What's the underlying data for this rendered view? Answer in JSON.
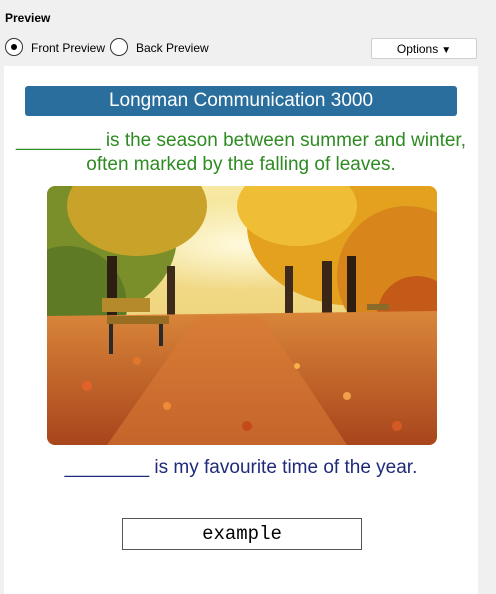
{
  "header": {
    "title": "Preview"
  },
  "preview_mode": {
    "front_label": "Front Preview",
    "back_label": "Back Preview",
    "selected": "front"
  },
  "options": {
    "label": "Options",
    "caret": "▼"
  },
  "card": {
    "deck_name": "Longman Communication 3000",
    "sentence_1": "________ is the season between summer and winter, often marked by the falling of leaves.",
    "image_description_icon": "autumn-park-photo",
    "sentence_2": "________ is my favourite time of the year.",
    "answer_value": "example"
  },
  "colors": {
    "banner": "#2a6e9e",
    "sentence_1": "#2e8b22",
    "sentence_2": "#1f2a7a"
  }
}
